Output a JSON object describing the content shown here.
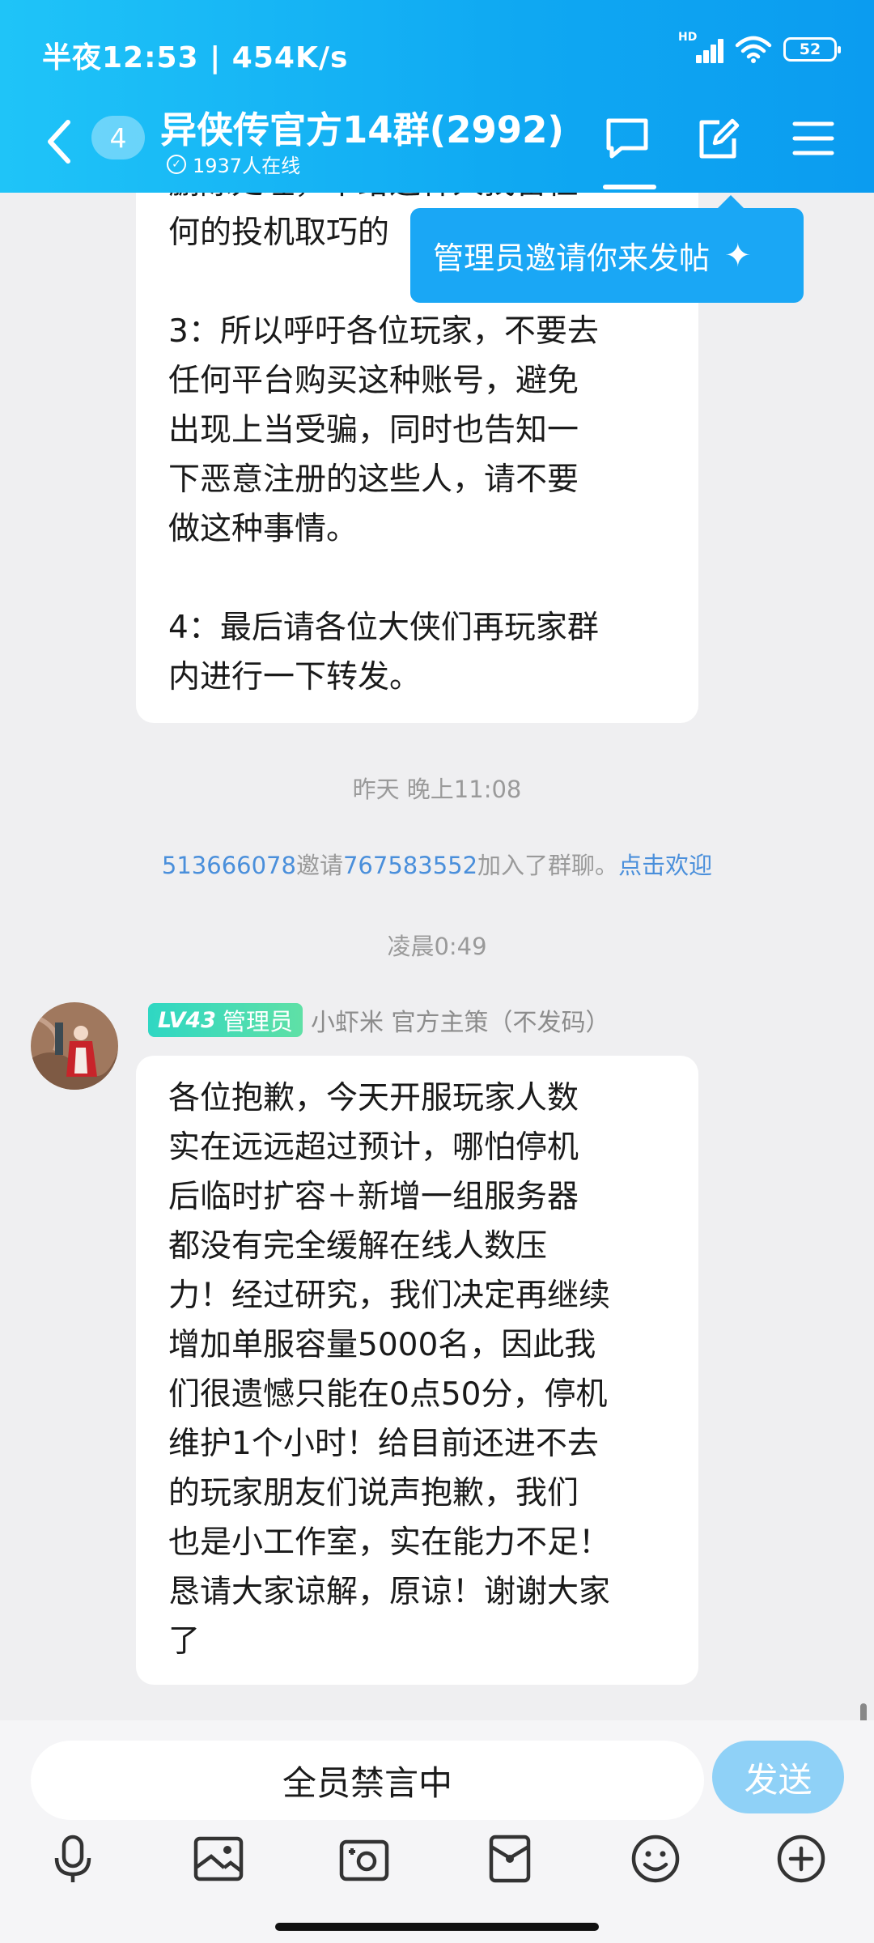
{
  "status_bar": {
    "time": "半夜12:53 | 454K/s",
    "hd": "HD",
    "battery": "52"
  },
  "header": {
    "unread_count": "4",
    "title": "异侠传官方14群(2992)",
    "online": "1937人在线"
  },
  "tooltip": {
    "text": "管理员邀请你来发帖",
    "sparkle": "✦"
  },
  "message1": {
    "lines": [
      "删除处理，不给这种人找留任",
      "何的投机取巧的",
      "",
      "3：所以呼吁各位玩家，不要去",
      "任何平台购买这种账号，避免",
      "出现上当受骗，同时也告知一",
      "下恶意注册的这些人，请不要",
      "做这种事情。",
      "",
      "4：最后请各位大侠们再玩家群",
      "内进行一下转发。"
    ]
  },
  "timestamp1": "昨天 晚上11:08",
  "invite": {
    "inviter": "513666078",
    "verb": "邀请",
    "invitee": "767583552",
    "suffix": "加入了群聊。",
    "welcome_link": "点击欢迎"
  },
  "timestamp2": "凌晨0:49",
  "sender": {
    "level": "LV43",
    "role": "管理员",
    "name": "小虾米 官方主策（不发码）"
  },
  "message2": {
    "lines": [
      "各位抱歉，今天开服玩家人数",
      "实在远远超过预计，哪怕停机",
      "后临时扩容＋新增一组服务器",
      "都没有完全缓解在线人数压",
      "力！经过研究，我们决定再继续",
      "增加单服容量5000名，因此我",
      "们很遗憾只能在0点50分，停机",
      "维护1个小时！给目前还进不去",
      "的玩家朋友们说声抱歉，我们",
      "也是小工作室，实在能力不足！",
      "恳请大家谅解，原谅！谢谢大家",
      "了"
    ]
  },
  "input": {
    "muted_text": "全员禁言中",
    "send_label": "发送"
  },
  "toolbar_icons": [
    "microphone-icon",
    "image-icon",
    "camera-icon",
    "red-packet-icon",
    "emoji-icon",
    "plus-icon"
  ]
}
